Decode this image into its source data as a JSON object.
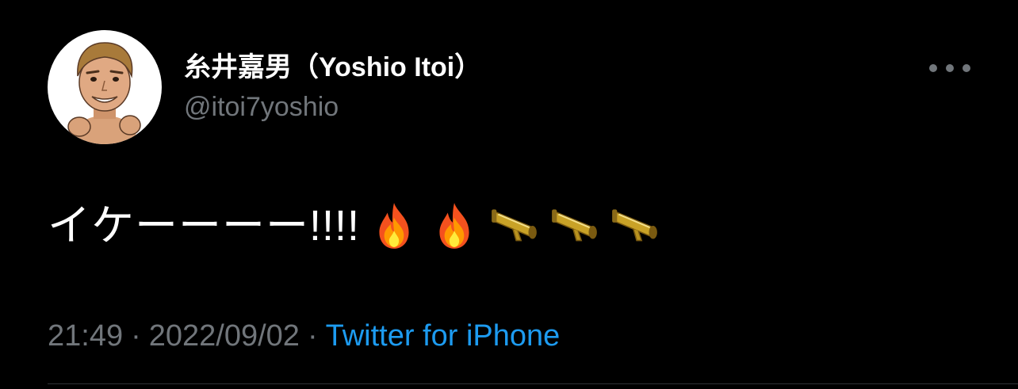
{
  "tweet": {
    "display_name": "糸井嘉男（Yoshio Itoi）",
    "handle": "@itoi7yoshio",
    "text": "イケーーーー!!!!",
    "emojis": [
      "fire-emoji",
      "fire-emoji",
      "megaphone-emoji",
      "megaphone-emoji",
      "megaphone-emoji"
    ],
    "time": "21:49",
    "date": "2022/09/02",
    "separator": "·",
    "source": "Twitter for iPhone"
  },
  "icons": {
    "more": "more-horizontal-icon",
    "avatar": "avatar-illustration"
  },
  "colors": {
    "background": "#000000",
    "text_primary": "#ffffff",
    "text_secondary": "#71767b",
    "link": "#1d9bf0",
    "divider": "#2f3336"
  }
}
